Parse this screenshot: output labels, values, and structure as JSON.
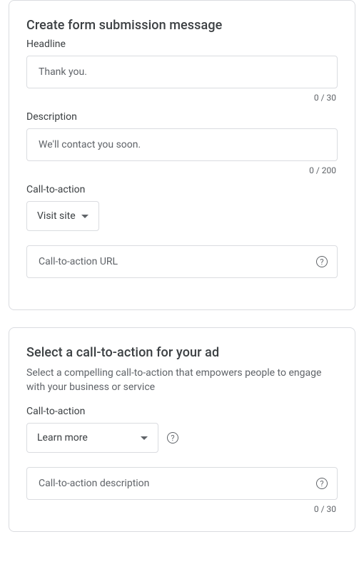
{
  "form_submission": {
    "title": "Create form submission message",
    "headline_label": "Headline",
    "headline_placeholder": "Thank you.",
    "headline_counter": "0 / 30",
    "description_label": "Description",
    "description_placeholder": "We'll contact you soon.",
    "description_counter": "0 / 200",
    "cta_label": "Call-to-action",
    "cta_selected": "Visit site",
    "cta_url_placeholder": "Call-to-action URL"
  },
  "ad_cta": {
    "title": "Select a call-to-action for your ad",
    "subtitle": "Select a compelling call-to-action that empowers people to engage with your business or service",
    "cta_label": "Call-to-action",
    "cta_selected": "Learn more",
    "cta_desc_placeholder": "Call-to-action description",
    "cta_desc_counter": "0 / 30"
  }
}
